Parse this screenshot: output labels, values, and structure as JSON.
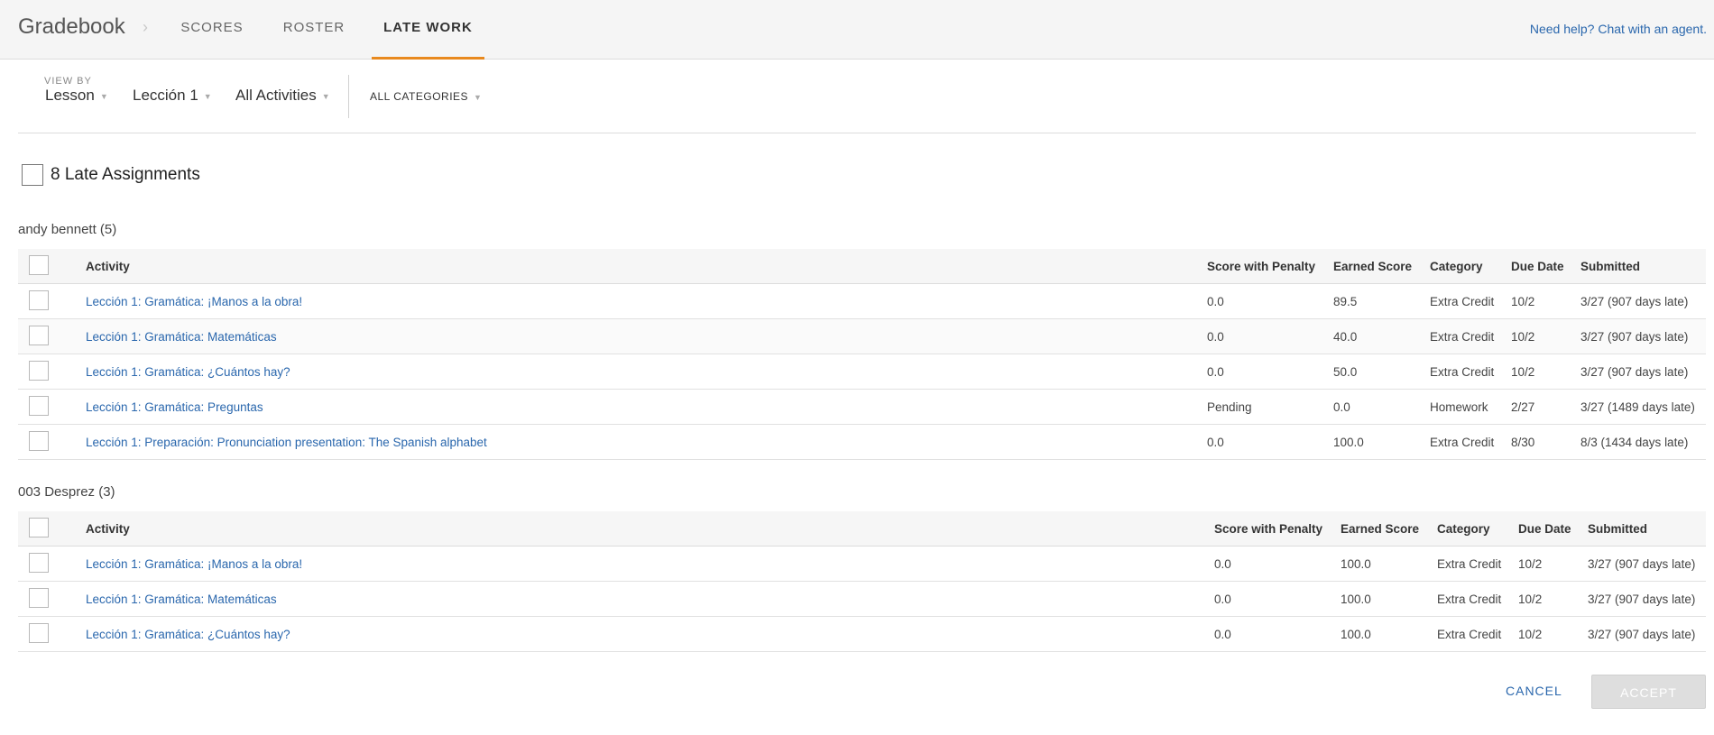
{
  "header": {
    "brand": "Gradebook",
    "separator": "›",
    "tabs": [
      {
        "label": "SCORES"
      },
      {
        "label": "ROSTER"
      },
      {
        "label": "LATE WORK"
      }
    ],
    "help_link": "Need help? Chat with an agent."
  },
  "filters": {
    "view_by_label": "VIEW BY",
    "view_by_value": "Lesson",
    "lesson_value": "Lección 1",
    "activities_value": "All Activities",
    "categories_value": "ALL CATEGORIES",
    "caret": "▼"
  },
  "summary": {
    "label": "8 Late Assignments"
  },
  "columns": [
    "Activity",
    "Score with Penalty",
    "Earned Score",
    "Category",
    "Due Date",
    "Submitted"
  ],
  "groups": [
    {
      "title": "andy bennett (5)",
      "rows": [
        {
          "activity": "Lección 1: Gramática: ¡Manos a la obra!",
          "score_penalty": "0.0",
          "earned": "89.5",
          "category": "Extra Credit",
          "due": "10/2",
          "submitted": "3/27 (907 days late)"
        },
        {
          "activity": "Lección 1: Gramática: Matemáticas",
          "score_penalty": "0.0",
          "earned": "40.0",
          "category": "Extra Credit",
          "due": "10/2",
          "submitted": "3/27 (907 days late)"
        },
        {
          "activity": "Lección 1: Gramática: ¿Cuántos hay?",
          "score_penalty": "0.0",
          "earned": "50.0",
          "category": "Extra Credit",
          "due": "10/2",
          "submitted": "3/27 (907 days late)"
        },
        {
          "activity": "Lección 1: Gramática: Preguntas",
          "score_penalty": "Pending",
          "earned": "0.0",
          "category": "Homework",
          "due": "2/27",
          "submitted": "3/27 (1489 days late)"
        },
        {
          "activity": "Lección 1: Preparación: Pronunciation presentation: The Spanish alphabet",
          "score_penalty": "0.0",
          "earned": "100.0",
          "category": "Extra Credit",
          "due": "8/30",
          "submitted": "8/3 (1434 days late)"
        }
      ]
    },
    {
      "title": "003 Desprez (3)",
      "rows": [
        {
          "activity": "Lección 1: Gramática: ¡Manos a la obra!",
          "score_penalty": "0.0",
          "earned": "100.0",
          "category": "Extra Credit",
          "due": "10/2",
          "submitted": "3/27 (907 days late)"
        },
        {
          "activity": "Lección 1: Gramática: Matemáticas",
          "score_penalty": "0.0",
          "earned": "100.0",
          "category": "Extra Credit",
          "due": "10/2",
          "submitted": "3/27 (907 days late)"
        },
        {
          "activity": "Lección 1: Gramática: ¿Cuántos hay?",
          "score_penalty": "0.0",
          "earned": "100.0",
          "category": "Extra Credit",
          "due": "10/2",
          "submitted": "3/27 (907 days late)"
        }
      ]
    }
  ],
  "actions": {
    "cancel": "CANCEL",
    "accept": "ACCEPT"
  },
  "colors": {
    "accent_tab": "#e8891e",
    "link": "#2a67ad",
    "disabled_button": "#dedede"
  }
}
